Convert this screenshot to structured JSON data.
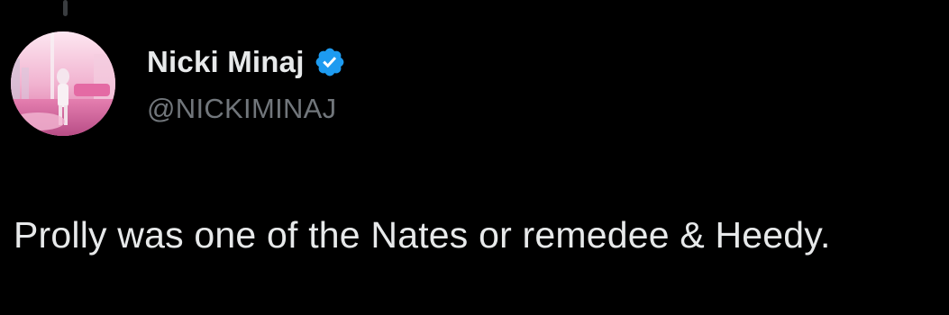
{
  "tweet": {
    "author": {
      "display_name": "Nicki Minaj",
      "handle": "@NICKIMINAJ",
      "verified": true,
      "avatar_icon": "profile-photo"
    },
    "text": "Prolly was one of the Nates or remedee & Heedy."
  },
  "colors": {
    "background": "#000000",
    "primary_text": "#e7e9ea",
    "secondary_text": "#71767b",
    "verified_badge": "#1d9bf0"
  }
}
